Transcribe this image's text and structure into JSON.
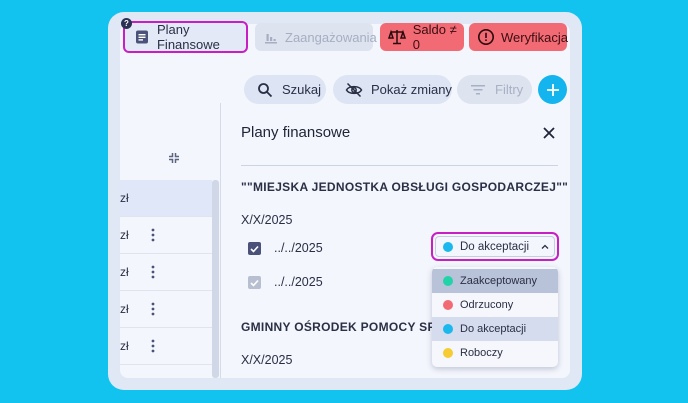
{
  "tabs": {
    "plany": {
      "label": "Plany Finansowe",
      "badge": "?"
    },
    "zaangazowania": {
      "label": "Zaangażowania"
    },
    "saldo": {
      "label": "Saldo ≠ 0"
    },
    "weryfikacja": {
      "label": "Weryfikacja"
    }
  },
  "toolbar": {
    "search_label": "Szukaj",
    "show_changes_label": "Pokaż zmiany",
    "filters_label": "Filtry",
    "add_label": "+"
  },
  "left_rows": [
    {
      "text": "zł",
      "has_menu": false
    },
    {
      "text": "zł",
      "has_menu": true
    },
    {
      "text": "zł",
      "has_menu": true
    },
    {
      "text": "zł",
      "has_menu": true
    },
    {
      "text": "zł",
      "has_menu": true
    }
  ],
  "panel": {
    "title": "Plany finansowe",
    "org1": "\"\"MIEJSKA JEDNOSTKA OBSŁUGI GOSPODARCZEJ\"\"",
    "org1_date": "X/X/2025",
    "items": [
      {
        "label": "../../2025",
        "checked": true
      },
      {
        "label": "../../2025",
        "checked": true,
        "disabled": true
      }
    ],
    "org2": "GMINNY OŚRODEK POMOCY SPOŁ",
    "org2_date": "X/X/2025"
  },
  "status_select": {
    "value": "Do akceptacji",
    "value_color": "#1bb8ee"
  },
  "status_options": [
    {
      "label": "Zaakceptowany",
      "color": "#22d3a8"
    },
    {
      "label": "Odrzucony",
      "color": "#f26b74"
    },
    {
      "label": "Do akceptacji",
      "color": "#1bb8ee"
    },
    {
      "label": "Roboczy",
      "color": "#f5cc33"
    }
  ]
}
